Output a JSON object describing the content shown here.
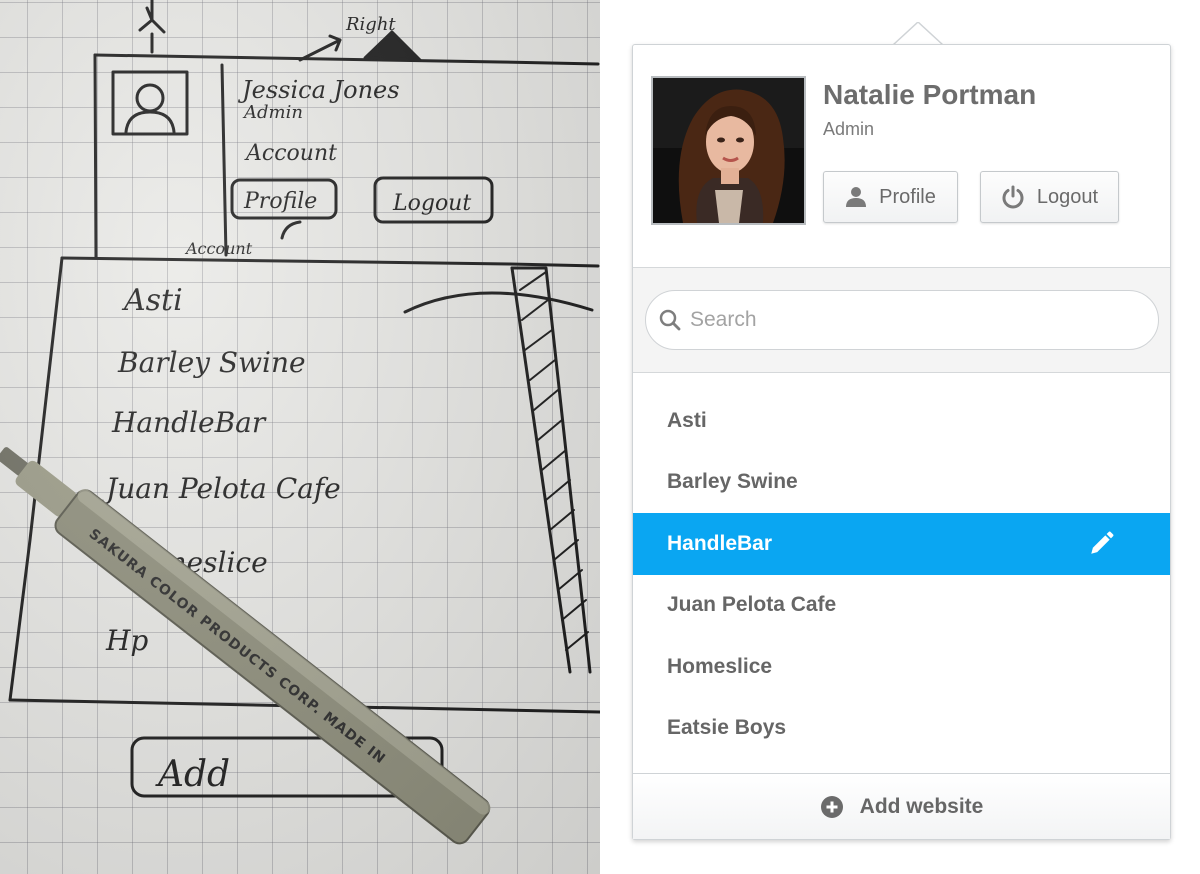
{
  "sketch": {
    "name": "Jessica Jones",
    "role": "Admin",
    "account_label": "Account",
    "right_label": "Right",
    "profile_label": "Profile",
    "logout_label": "Logout",
    "account_arrow_label": "Account",
    "items": [
      "Asti",
      "Barley Swine",
      "HandleBar",
      "Juan Pelota Cafe",
      "meslice",
      "Hp"
    ],
    "add_label": "Add",
    "pen_text": "SAKURA COLOR PRODUCTS CORP. MADE IN"
  },
  "user": {
    "name": "Natalie Portman",
    "role": "Admin"
  },
  "buttons": {
    "profile": "Profile",
    "logout": "Logout"
  },
  "search": {
    "placeholder": "Search",
    "value": ""
  },
  "websites": [
    {
      "label": "Asti",
      "selected": false
    },
    {
      "label": "Barley Swine",
      "selected": false
    },
    {
      "label": "HandleBar",
      "selected": true
    },
    {
      "label": "Juan Pelota Cafe",
      "selected": false
    },
    {
      "label": "Homeslice",
      "selected": false
    },
    {
      "label": "Eatsie Boys",
      "selected": false
    }
  ],
  "footer": {
    "add_label": "Add website"
  },
  "colors": {
    "accent": "#0aa6f2",
    "text": "#666666",
    "border": "#cfd3d6"
  },
  "icons": [
    "person-icon",
    "power-icon",
    "search-icon",
    "pencil-icon",
    "plus-circle-icon"
  ]
}
